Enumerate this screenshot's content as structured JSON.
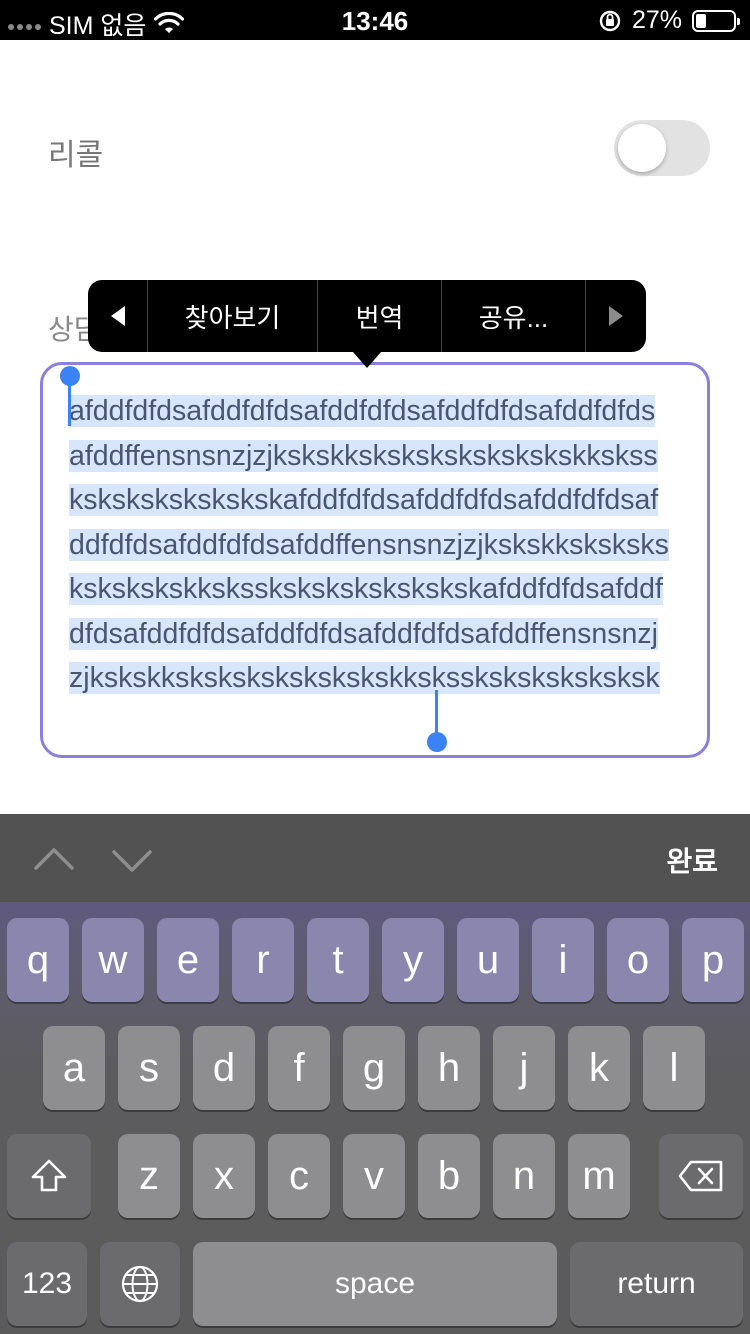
{
  "status_bar": {
    "carrier": "SIM 없음",
    "time": "13:46",
    "battery": "27%",
    "icons": [
      "signal-dots-icon",
      "wifi-icon",
      "orientation-lock-icon",
      "battery-icon"
    ]
  },
  "settings": {
    "recall_label": "리콜",
    "recall_toggle_on": false,
    "section_label_partial": "상담"
  },
  "text_area": {
    "content": "afddfdfdsafddfdfdsafddfdfdsafddfdfdsafddfdfdsafddffensnsnzjzjksksk​kskskskskskskskskkskssksksksksksk​skskafddfdfdsafddfdfdsafddfdfdsafddfdfdsafddfdfdsafddffensnsnzjzjksksk​kskskskskskskskskkskssksksksksk​sksk​skafddfdfdsafddfdfdsafddfdfdsafddfdfdsafddfdfdsafddffensnsnzjzjksksk​kskskskskskskskskkskssksksksksksk​sk",
    "border_color": "#8c7fdc",
    "selection_color": "#d8e6fc"
  },
  "edit_menu": {
    "prev_icon": "triangle-left-icon",
    "lookup": "찾아보기",
    "translate": "번역",
    "share": "공유...",
    "next_icon": "triangle-right-icon"
  },
  "keyboard_toolbar": {
    "prev_icon": "chevron-up-icon",
    "next_icon": "chevron-down-icon",
    "done": "완료"
  },
  "keyboard": {
    "row1": [
      "q",
      "w",
      "e",
      "r",
      "t",
      "y",
      "u",
      "i",
      "o",
      "p"
    ],
    "row2": [
      "a",
      "s",
      "d",
      "f",
      "g",
      "h",
      "j",
      "k",
      "l"
    ],
    "row3": [
      "z",
      "x",
      "c",
      "v",
      "b",
      "n",
      "m"
    ],
    "shift_icon": "shift-icon",
    "delete_icon": "delete-icon",
    "numbers": "123",
    "globe_icon": "globe-icon",
    "space": "space",
    "return": "return"
  }
}
